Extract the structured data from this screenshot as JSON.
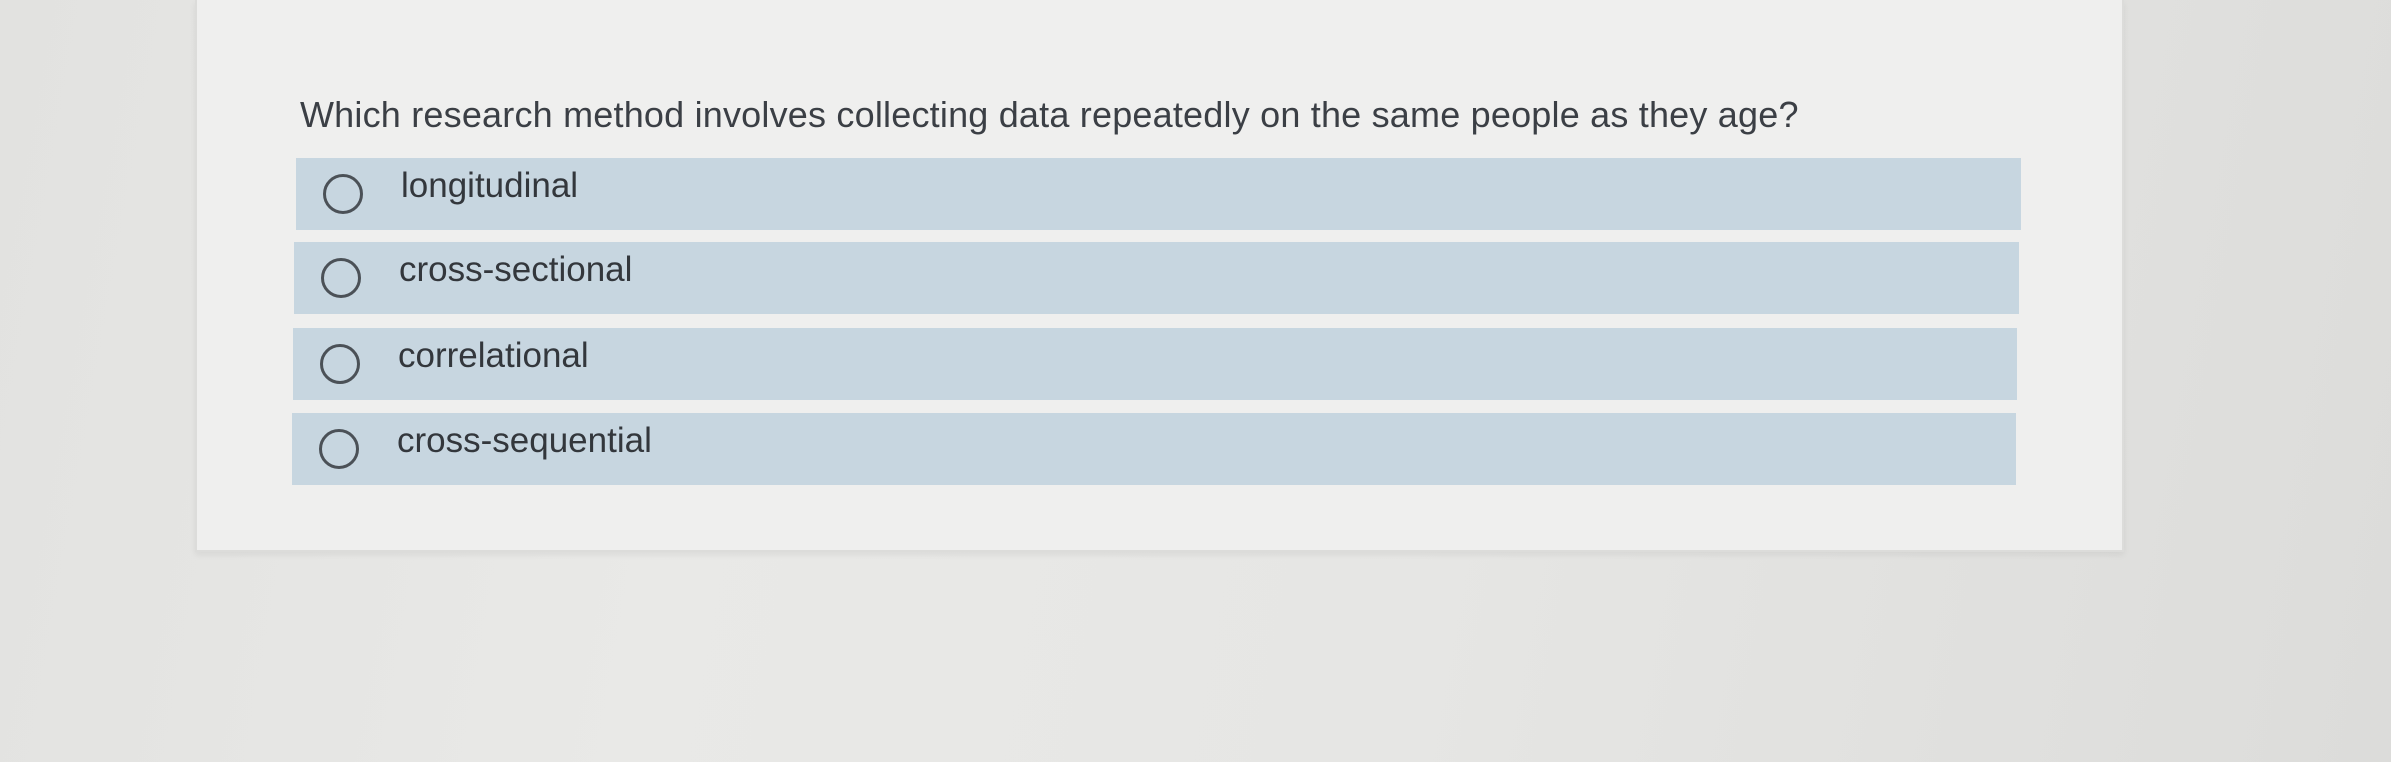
{
  "question": {
    "text": "Which research method involves collecting data repeatedly on the same people as they age?"
  },
  "options": [
    {
      "label": "longitudinal",
      "selected": false
    },
    {
      "label": "cross-sectional",
      "selected": false
    },
    {
      "label": "correlational",
      "selected": false
    },
    {
      "label": "cross-sequential",
      "selected": false
    }
  ],
  "colors": {
    "option_background": "#c7d6e0",
    "card_background": "#efefee",
    "text": "#3b3f45"
  }
}
